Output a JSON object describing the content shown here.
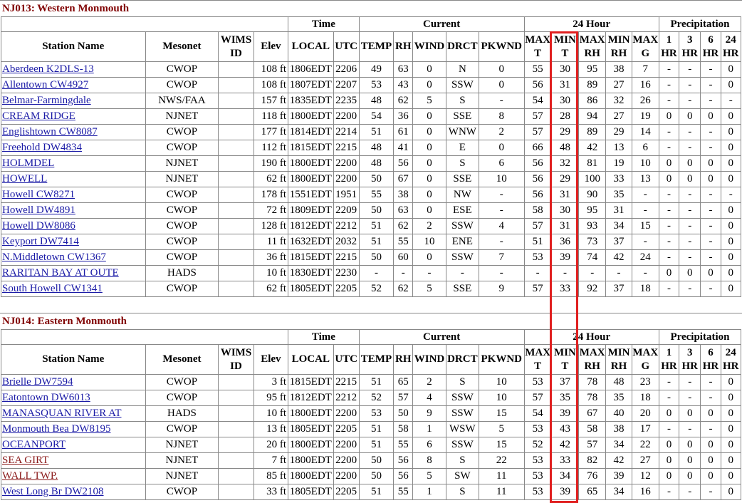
{
  "zones": [
    {
      "title": "NJ013: Western Monmouth",
      "stations": [
        [
          "Aberdeen K2DLS-13",
          "CWOP",
          "",
          "108 ft",
          "1806EDT",
          "2206",
          "49",
          "63",
          "0",
          "N",
          "0",
          "55",
          "30",
          "95",
          "38",
          "7",
          "-",
          "-",
          "-",
          "0"
        ],
        [
          "Allentown CW4927",
          "CWOP",
          "",
          "108 ft",
          "1807EDT",
          "2207",
          "53",
          "43",
          "0",
          "SSW",
          "0",
          "56",
          "31",
          "89",
          "27",
          "16",
          "-",
          "-",
          "-",
          "0"
        ],
        [
          "Belmar-Farmingdale",
          "NWS/FAA",
          "",
          "157 ft",
          "1835EDT",
          "2235",
          "48",
          "62",
          "5",
          "S",
          "-",
          "54",
          "30",
          "86",
          "32",
          "26",
          "-",
          "-",
          "-",
          "-"
        ],
        [
          "CREAM RIDGE",
          "NJNET",
          "",
          "118 ft",
          "1800EDT",
          "2200",
          "54",
          "36",
          "0",
          "SSE",
          "8",
          "57",
          "28",
          "94",
          "27",
          "19",
          "0",
          "0",
          "0",
          "0"
        ],
        [
          "Englishtown CW8087",
          "CWOP",
          "",
          "177 ft",
          "1814EDT",
          "2214",
          "51",
          "61",
          "0",
          "WNW",
          "2",
          "57",
          "29",
          "89",
          "29",
          "14",
          "-",
          "-",
          "-",
          "0"
        ],
        [
          "Freehold DW4834",
          "CWOP",
          "",
          "112 ft",
          "1815EDT",
          "2215",
          "48",
          "41",
          "0",
          "E",
          "0",
          "66",
          "48",
          "42",
          "13",
          "6",
          "-",
          "-",
          "-",
          "0"
        ],
        [
          "HOLMDEL",
          "NJNET",
          "",
          "190 ft",
          "1800EDT",
          "2200",
          "48",
          "56",
          "0",
          "S",
          "6",
          "56",
          "32",
          "81",
          "19",
          "10",
          "0",
          "0",
          "0",
          "0"
        ],
        [
          "HOWELL",
          "NJNET",
          "",
          "62 ft",
          "1800EDT",
          "2200",
          "50",
          "67",
          "0",
          "SSE",
          "10",
          "56",
          "29",
          "100",
          "33",
          "13",
          "0",
          "0",
          "0",
          "0"
        ],
        [
          "Howell CW8271",
          "CWOP",
          "",
          "178 ft",
          "1551EDT",
          "1951",
          "55",
          "38",
          "0",
          "NW",
          "-",
          "56",
          "31",
          "90",
          "35",
          "-",
          "-",
          "-",
          "-",
          "-"
        ],
        [
          "Howell DW4891",
          "CWOP",
          "",
          "72 ft",
          "1809EDT",
          "2209",
          "50",
          "63",
          "0",
          "ESE",
          "-",
          "58",
          "30",
          "95",
          "31",
          "-",
          "-",
          "-",
          "-",
          "0"
        ],
        [
          "Howell DW8086",
          "CWOP",
          "",
          "128 ft",
          "1812EDT",
          "2212",
          "51",
          "62",
          "2",
          "SSW",
          "4",
          "57",
          "31",
          "93",
          "34",
          "15",
          "-",
          "-",
          "-",
          "0"
        ],
        [
          "Keyport DW7414",
          "CWOP",
          "",
          "11 ft",
          "1632EDT",
          "2032",
          "51",
          "55",
          "10",
          "ENE",
          "-",
          "51",
          "36",
          "73",
          "37",
          "-",
          "-",
          "-",
          "-",
          "0"
        ],
        [
          "N.Middletown CW1367",
          "CWOP",
          "",
          "36 ft",
          "1815EDT",
          "2215",
          "50",
          "60",
          "0",
          "SSW",
          "7",
          "53",
          "39",
          "74",
          "42",
          "24",
          "-",
          "-",
          "-",
          "0"
        ],
        [
          "RARITAN BAY AT OUTE",
          "HADS",
          "",
          "10 ft",
          "1830EDT",
          "2230",
          "-",
          "-",
          "-",
          "-",
          "-",
          "-",
          "-",
          "-",
          "-",
          "-",
          "0",
          "0",
          "0",
          "0"
        ],
        [
          "South Howell CW1341",
          "CWOP",
          "",
          "62 ft",
          "1805EDT",
          "2205",
          "52",
          "62",
          "5",
          "SSE",
          "9",
          "57",
          "33",
          "92",
          "37",
          "18",
          "-",
          "-",
          "-",
          "0"
        ]
      ]
    },
    {
      "title": "NJ014: Eastern Monmouth",
      "stations": [
        [
          "Brielle DW7594",
          "CWOP",
          "",
          "3 ft",
          "1815EDT",
          "2215",
          "51",
          "65",
          "2",
          "S",
          "10",
          "53",
          "37",
          "78",
          "48",
          "23",
          "-",
          "-",
          "-",
          "0"
        ],
        [
          "Eatontown DW6013",
          "CWOP",
          "",
          "95 ft",
          "1812EDT",
          "2212",
          "52",
          "57",
          "4",
          "SSW",
          "10",
          "57",
          "35",
          "78",
          "35",
          "18",
          "-",
          "-",
          "-",
          "0"
        ],
        [
          "MANASQUAN RIVER AT",
          "HADS",
          "",
          "10 ft",
          "1800EDT",
          "2200",
          "53",
          "50",
          "9",
          "SSW",
          "15",
          "54",
          "39",
          "67",
          "40",
          "20",
          "0",
          "0",
          "0",
          "0"
        ],
        [
          "Monmouth Bea DW8195",
          "CWOP",
          "",
          "13 ft",
          "1805EDT",
          "2205",
          "51",
          "58",
          "1",
          "WSW",
          "5",
          "53",
          "43",
          "58",
          "38",
          "17",
          "-",
          "-",
          "-",
          "0"
        ],
        [
          "OCEANPORT",
          "NJNET",
          "",
          "20 ft",
          "1800EDT",
          "2200",
          "51",
          "55",
          "6",
          "SSW",
          "15",
          "52",
          "42",
          "57",
          "34",
          "22",
          "0",
          "0",
          "0",
          "0"
        ],
        [
          "SEA GIRT",
          "NJNET",
          "",
          "7 ft",
          "1800EDT",
          "2200",
          "50",
          "56",
          "8",
          "S",
          "22",
          "53",
          "33",
          "82",
          "42",
          "27",
          "0",
          "0",
          "0",
          "0"
        ],
        [
          "WALL TWP.",
          "NJNET",
          "",
          "85 ft",
          "1800EDT",
          "2200",
          "50",
          "56",
          "5",
          "SW",
          "11",
          "53",
          "34",
          "76",
          "39",
          "12",
          "0",
          "0",
          "0",
          "0"
        ],
        [
          "West Long Br DW2108",
          "CWOP",
          "",
          "33 ft",
          "1805EDT",
          "2205",
          "51",
          "55",
          "1",
          "S",
          "11",
          "53",
          "39",
          "65",
          "34",
          "16",
          "-",
          "-",
          "-",
          "0"
        ]
      ]
    }
  ],
  "visited": [
    "SEA GIRT",
    "WALL TWP."
  ],
  "groups": {
    "time": "Time",
    "current": "Current",
    "hour24": "24 Hour",
    "precip": "Precipitation"
  },
  "columns": [
    "Station Name",
    "Mesonet",
    "WIMS ID",
    "Elev",
    "LOCAL",
    "UTC",
    "TEMP",
    "RH",
    "WIND",
    "DRCT",
    "PKWND",
    "MAX T",
    "MIN T",
    "MAX RH",
    "MIN RH",
    "MAX G",
    "1 HR",
    "3 HR",
    "6 HR",
    "24 HR"
  ],
  "highlight_color": "#e02020"
}
